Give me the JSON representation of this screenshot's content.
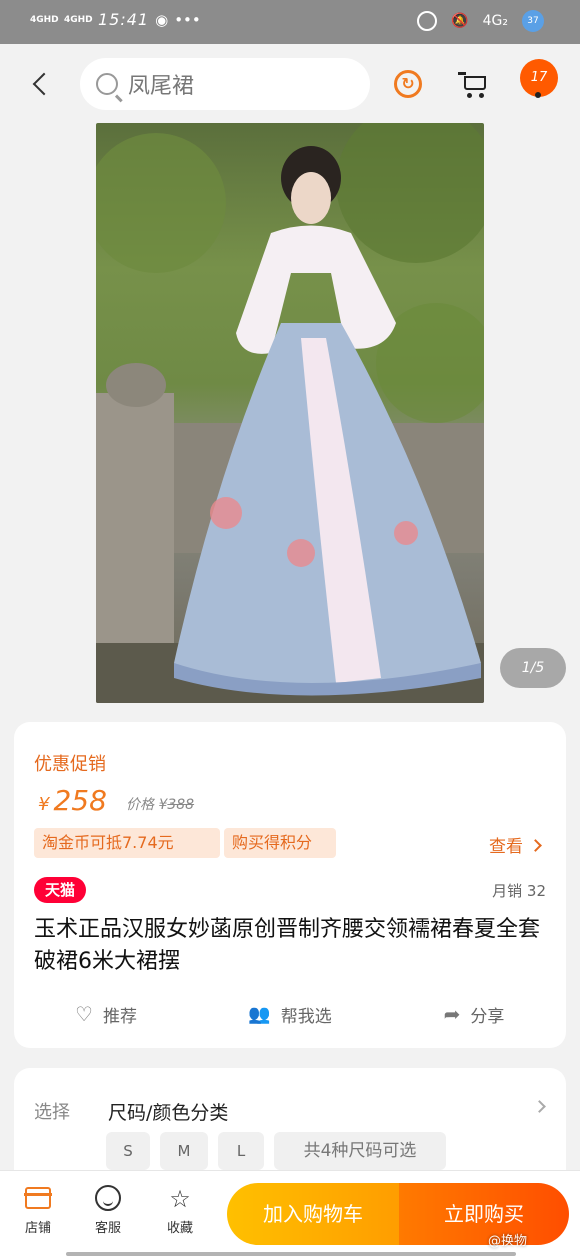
{
  "status_bar": {
    "signal1": "4GHD",
    "signal2": "4GHD",
    "time": "15:41",
    "dots": "•••",
    "network": "4G₂",
    "battery": "37"
  },
  "header": {
    "search_query": "凤尾裙",
    "message_count": "17"
  },
  "gallery": {
    "counter": "1/5"
  },
  "product": {
    "promo_label": "优惠促销",
    "currency": "¥",
    "price": "258",
    "orig_label": "价格 ¥",
    "orig_price": "388",
    "coin_badge": "淘金币可抵7.74元",
    "points_badge": "购买得积分",
    "view_link": "查看",
    "store_badge": "天猫",
    "monthly_sales": "月销 32",
    "title": "玉术正品汉服女妙菡原创晋制齐腰交领襦裙春夏全套破裙6米大裙摆",
    "actions": {
      "recommend": "推荐",
      "help_choose": "帮我选",
      "share": "分享"
    }
  },
  "selection": {
    "label": "选择",
    "value": "尺码/颜色分类",
    "sizes": [
      "S",
      "M",
      "L"
    ],
    "count_text": "共4种尺码可选"
  },
  "bottom_bar": {
    "store": "店铺",
    "service": "客服",
    "favorite": "收藏",
    "add_to_cart": "加入购物车",
    "buy_now": "立即购买",
    "watermark": "@换物"
  },
  "colors": {
    "accent_orange": "#f07a20",
    "tmall_red": "#ff0036",
    "cart_yellow": "#ffc000",
    "buy_orange": "#ff5a00"
  }
}
